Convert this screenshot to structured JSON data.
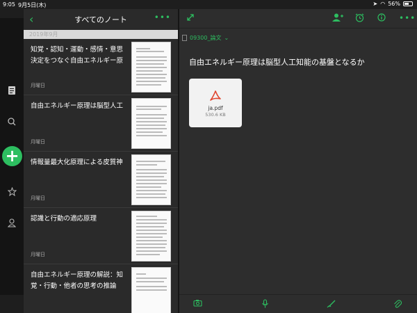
{
  "status": {
    "time": "9:05",
    "date": "9月5日(木)",
    "battery": "56%",
    "battery_level": 0.56
  },
  "notes_panel": {
    "title": "すべてのノート",
    "date_separator": "2019年9月",
    "items": [
      {
        "title": "知覚・認知・運動・感情・意思決定をつなぐ自由エネルギー原",
        "date": "月曜日"
      },
      {
        "title": "自由エネルギー原理は脳型人工",
        "date": "月曜日"
      },
      {
        "title": "情報量最大化原理による皮質神",
        "date": "月曜日"
      },
      {
        "title": "認識と行動の適応原理",
        "date": "月曜日"
      },
      {
        "title": "自由エネルギー原理の解説：知覚・行動・他者の思考の推論",
        "date": ""
      }
    ]
  },
  "editor": {
    "notebook": "09300_論文",
    "title": "自由エネルギー原理は脳型人工知能の基盤となるか",
    "attachment": {
      "name": "ja.pdf",
      "size": "530.6 KB"
    }
  },
  "icons": {
    "sidebar": [
      "notes-icon",
      "search-icon",
      "add-icon",
      "star-icon",
      "account-icon"
    ],
    "top_toolbar": [
      "expand-icon",
      "add-user-icon",
      "alarm-icon",
      "info-icon",
      "more-icon"
    ],
    "bottom_toolbar": [
      "camera-icon",
      "audio-icon",
      "handwriting-icon",
      "attachment-icon"
    ]
  },
  "colors": {
    "accent": "#2dbe60",
    "pdf": "#e0442e"
  }
}
